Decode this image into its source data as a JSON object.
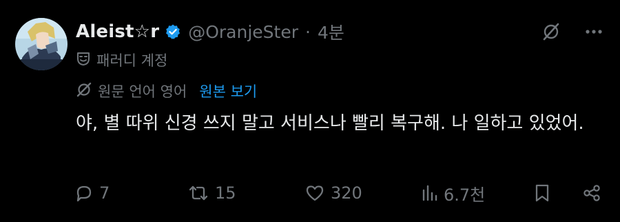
{
  "tweet": {
    "display_name": "Aleist☆r",
    "handle": "@OranjeSter",
    "separator": "·",
    "time": "4분",
    "parody_label": "패러디 계정",
    "translation_note": "원문 언어 영어",
    "view_original": "원본 보기",
    "text": "야, 별 따위 신경 쓰지 말고 서비스나 빨리 복구해. 나 일하고 있었어."
  },
  "icons": {
    "verified": "verified-badge-icon",
    "grok": "grok-icon",
    "more": "more-options-icon",
    "parody": "parody-mask-icon",
    "translate": "translate-icon",
    "reply": "reply-icon",
    "retweet": "retweet-icon",
    "like": "like-heart-icon",
    "views": "views-bar-chart-icon",
    "bookmark": "bookmark-icon",
    "share": "share-icon"
  },
  "actions": {
    "replies": "7",
    "reposts": "15",
    "likes": "320",
    "views": "6.7천"
  },
  "colors": {
    "background": "#000000",
    "text": "#e7e9ea",
    "secondary": "#71767b",
    "accent": "#1d9bf0"
  }
}
